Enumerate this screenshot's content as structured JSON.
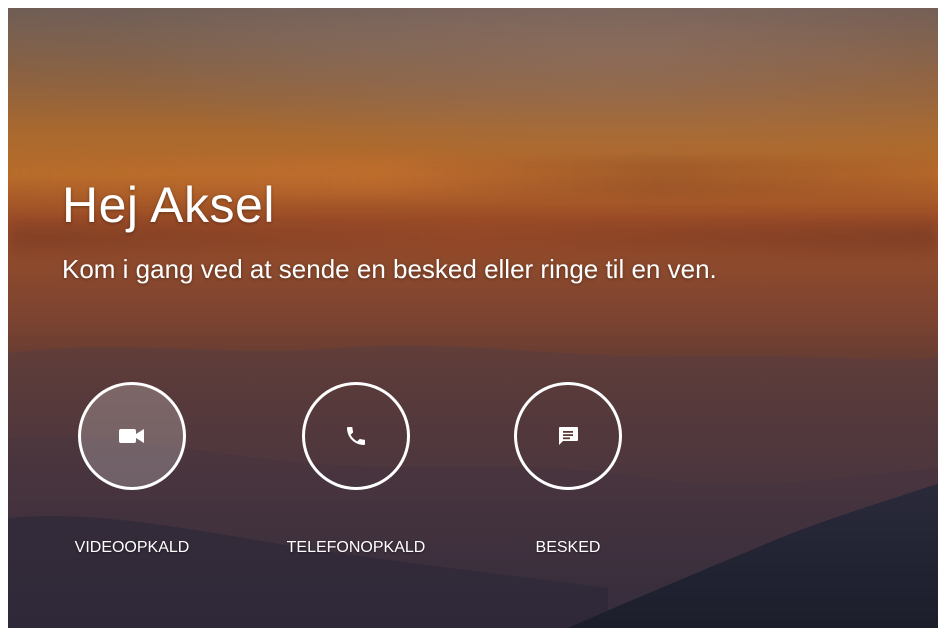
{
  "greeting": {
    "title": "Hej Aksel",
    "subtitle": "Kom i gang ved at sende en besked eller ringe til en ven."
  },
  "actions": [
    {
      "label": "VIDEOOPKALD",
      "icon": "video-camera-icon"
    },
    {
      "label": "TELEFONOPKALD",
      "icon": "phone-icon"
    },
    {
      "label": "BESKED",
      "icon": "message-icon"
    }
  ],
  "colors": {
    "text": "#ffffff",
    "ring": "#ffffff"
  }
}
